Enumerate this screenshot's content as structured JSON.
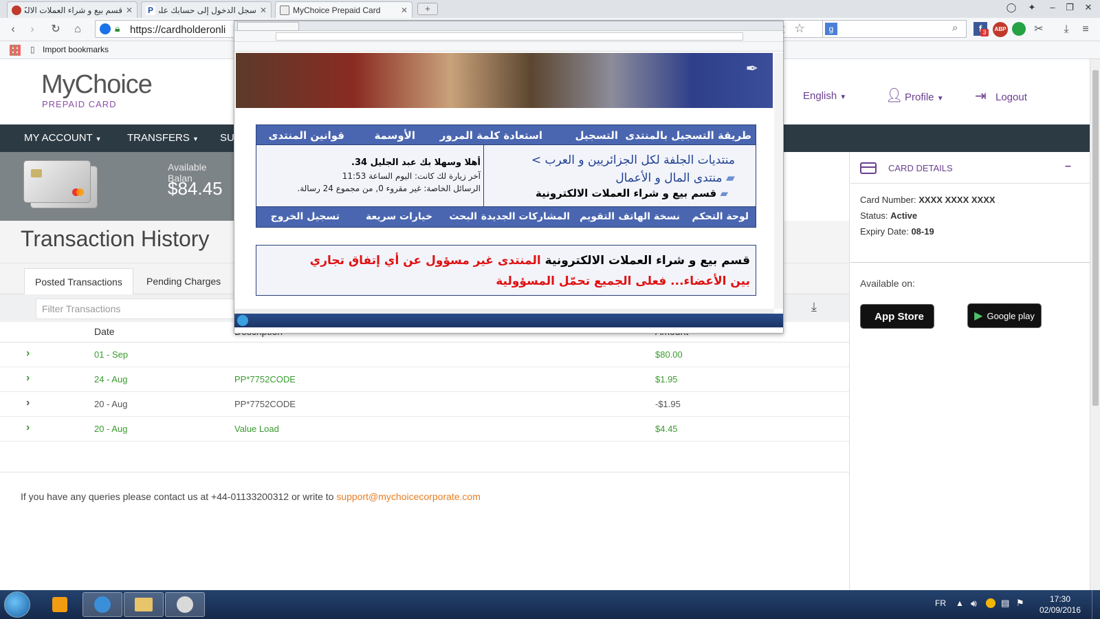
{
  "browser": {
    "tabs": [
      {
        "title": "قسم بيع و شراء العملات الالكترو",
        "favicon": "forum-favicon"
      },
      {
        "title": "سجل الدخول إلى حسابك على",
        "favicon": "paypal-favicon"
      },
      {
        "title": "MyChoice Prepaid Card",
        "favicon": "page-favicon"
      }
    ],
    "url": "https://cardholderonli",
    "bookmarks": {
      "import_label": "Import bookmarks"
    },
    "extension_badge": "3"
  },
  "site": {
    "logo_main": "MyChoice",
    "logo_sub": "PREPAID CARD",
    "header": {
      "language": "English",
      "profile": "Profile",
      "logout": "Logout"
    },
    "nav": {
      "my_account": "MY ACCOUNT",
      "transfers": "TRANSFERS",
      "partial": "SU"
    },
    "balance": {
      "label": "Available Balan",
      "amount": "$84.45"
    },
    "page_title": "Transaction History",
    "tabs": {
      "posted": "Posted Transactions",
      "pending": "Pending Charges"
    },
    "filter_placeholder": "Filter Transactions",
    "table": {
      "headers": {
        "date": "Date",
        "description": "Description",
        "amount": "Amount"
      },
      "rows": [
        {
          "date": "01 - Sep",
          "description": "",
          "amount": "$80.00"
        },
        {
          "date": "24 - Aug",
          "description": "PP*7752CODE",
          "amount": "$1.95"
        },
        {
          "date": "20 - Aug",
          "description": "PP*7752CODE",
          "amount": "-$1.95"
        },
        {
          "date": "20 - Aug",
          "description": "Value Load",
          "amount": "$4.45"
        }
      ]
    },
    "footer": {
      "text": "If you have any queries please contact us at +44-01133200312 or write to",
      "email": "support@mychoicecorporate.com"
    },
    "card_details": {
      "title": "CARD DETAILS",
      "collapse": "–",
      "number_label": "Card Number:",
      "number_value": "XXXX XXXX XXXX",
      "status_label": "Status:",
      "status_value": "Active",
      "expiry_label": "Expiry Date:",
      "expiry_value": "08-19",
      "available_on": "Available on:",
      "app_store": "App Store",
      "google_play": "Google play"
    }
  },
  "overlay": {
    "nav1": [
      "طريقة التسجيل بالمنتدى",
      "التسجيل",
      "استعادة كلمة المرور",
      "الأوسمة",
      "قوانين المنتدى"
    ],
    "breadcrumb_1": "منتديات الجلفة لكل الجزائريين و العرب",
    "breadcrumb_2": "منتدى المال و الأعمال",
    "breadcrumb_3": "قسم بيع و شراء العملات الالكترونية",
    "welcome": "أهلا وسهلا بك عبد الجليل 34.",
    "last_visit": "آخر زيارة لك كانت: اليوم الساعة 11:53",
    "messages": "الرسائل الخاصة: غير مقروء 0, من مجموع 24 رسالة.",
    "nav2": [
      "لوحة التحكم",
      "نسخة الهاتف",
      "التقويم",
      "المشاركات الجديدة",
      "البحث",
      "خيارات سريعة",
      "تسجيل الخروج"
    ],
    "notice_black": "قسم بيع و شراء العملات الالكترونية",
    "notice_red1": "المنتدى غير مسؤول عن أي إتفاق تجاري",
    "notice_red2": "بين الأعضاء... فعلى الجميع تحمّل المسؤولية"
  },
  "taskbar": {
    "lang": "FR",
    "time": "17:30",
    "date": "02/09/2016"
  },
  "colors": {
    "nav_bg": "#2c3a44",
    "accent_purple": "#6a3f8f",
    "green": "#3a9a2f",
    "link_orange": "#e67e22"
  }
}
